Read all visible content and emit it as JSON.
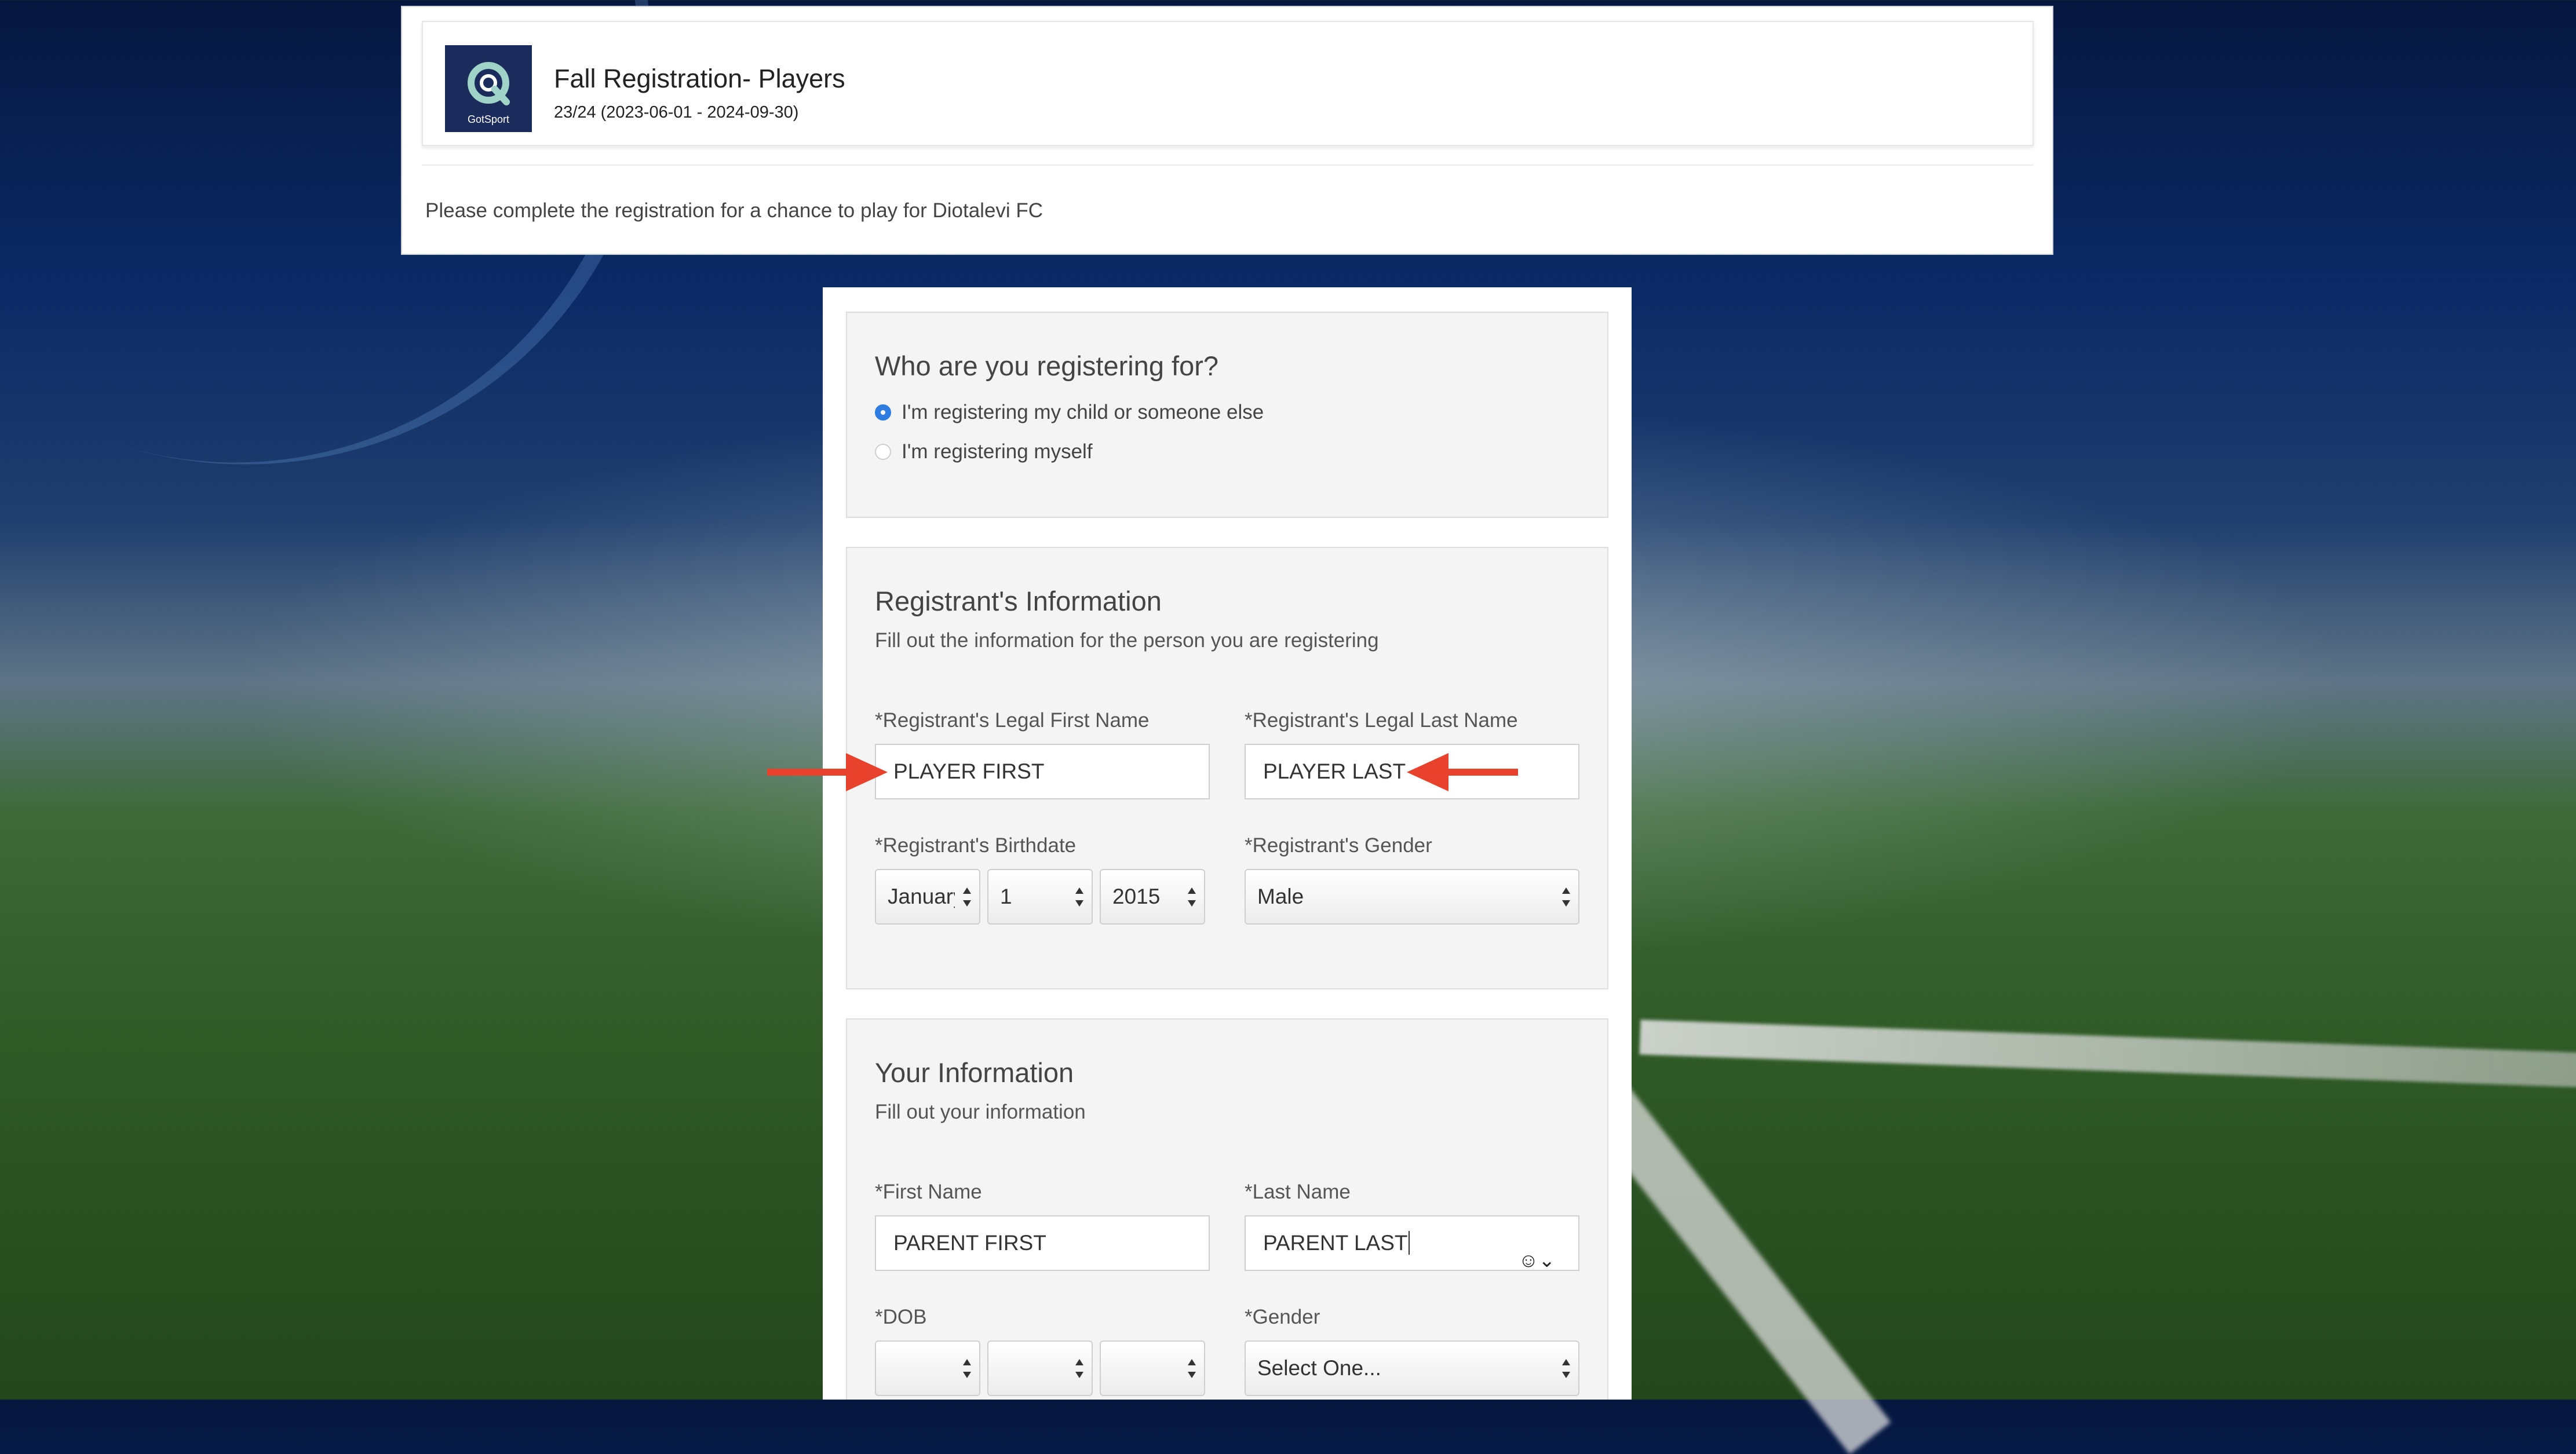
{
  "header": {
    "logo_text": "GotSport",
    "title": "Fall Registration- Players",
    "subtitle": "23/24 (2023-06-01 - 2024-09-30)",
    "note": "Please complete the registration for a chance to play for Diotalevi FC"
  },
  "who": {
    "title": "Who are you registering for?",
    "options": [
      {
        "label": "I'm registering my child or someone else",
        "selected": true
      },
      {
        "label": "I'm registering myself",
        "selected": false
      }
    ]
  },
  "registrant": {
    "title": "Registrant's Information",
    "description": "Fill out the information for the person you are registering",
    "first_name_label": "*Registrant's Legal First Name",
    "first_name_value": "PLAYER FIRST",
    "last_name_label": "*Registrant's Legal Last Name",
    "last_name_value": "PLAYER LAST",
    "birthdate_label": "*Registrant's Birthdate",
    "birth_month": "January",
    "birth_day": "1",
    "birth_year": "2015",
    "gender_label": "*Registrant's Gender",
    "gender_value": "Male"
  },
  "yours": {
    "title": "Your Information",
    "description": "Fill out your information",
    "first_name_label": "*First Name",
    "first_name_value": "PARENT FIRST",
    "last_name_label": "*Last Name",
    "last_name_value": "PARENT LAST",
    "dob_label": "*DOB",
    "dob_month": "",
    "dob_day": "",
    "dob_year": "",
    "gender_label": "*Gender",
    "gender_value": "Select One..."
  },
  "colors": {
    "accent_radio": "#2f7de1",
    "annotation_arrow": "#e8412c"
  }
}
